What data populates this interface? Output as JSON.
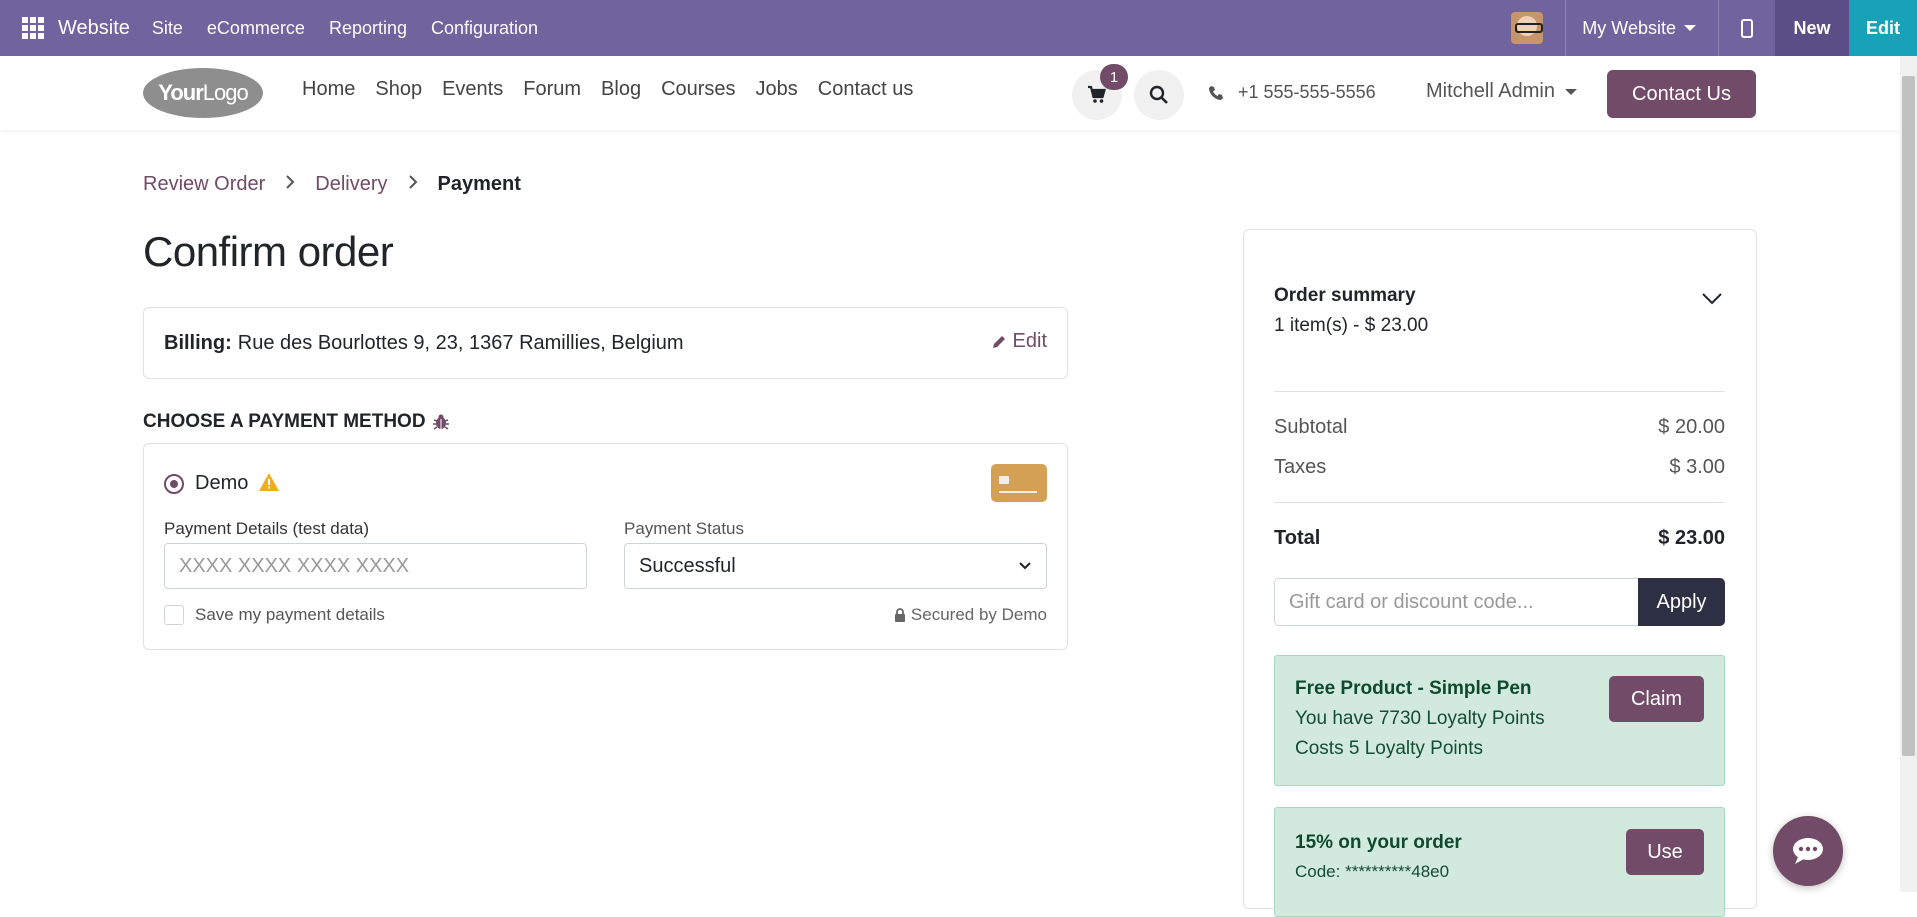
{
  "admin_bar": {
    "brand": "Website",
    "menus": [
      "Site",
      "eCommerce",
      "Reporting",
      "Configuration"
    ],
    "website_selector": "My Website",
    "new_label": "New",
    "edit_label": "Edit",
    "color": "#71639e"
  },
  "header": {
    "logo_bold": "Your",
    "logo_light": "Logo",
    "nav": [
      "Home",
      "Shop",
      "Events",
      "Forum",
      "Blog",
      "Courses",
      "Jobs",
      "Contact us"
    ],
    "cart_count": "1",
    "phone": "+1 555-555-5556",
    "user": "Mitchell Admin",
    "contact_button": "Contact Us",
    "accent": "#714b67"
  },
  "breadcrumb": {
    "step1": "Review Order",
    "step2": "Delivery",
    "step3": "Payment"
  },
  "page_title": "Confirm order",
  "billing": {
    "label": "Billing:",
    "address": "Rue des Bourlottes 9, 23, 1367 Ramillies, Belgium",
    "edit": "Edit"
  },
  "payment": {
    "heading": "CHOOSE A PAYMENT METHOD",
    "method": "Demo",
    "details_label": "Payment Details (test data)",
    "details_placeholder": "XXXX XXXX XXXX XXXX",
    "status_label": "Payment Status",
    "status_value": "Successful",
    "save_label": "Save my payment details",
    "secured": "Secured by Demo"
  },
  "summary": {
    "title": "Order summary",
    "items_line": "1 item(s) -  $ 23.00",
    "subtotal_label": "Subtotal",
    "subtotal_value": "$ 20.00",
    "taxes_label": "Taxes",
    "taxes_value": "$ 3.00",
    "total_label": "Total",
    "total_value": "$ 23.00",
    "promo_placeholder": "Gift card or discount code...",
    "apply": "Apply"
  },
  "rewards": [
    {
      "title": "Free Product - Simple Pen",
      "line1": "You have 7730 Loyalty Points",
      "line2": "Costs 5 Loyalty Points",
      "button": "Claim"
    },
    {
      "title": "15% on your order",
      "line1": "Code: **********48e0",
      "button": "Use"
    }
  ]
}
